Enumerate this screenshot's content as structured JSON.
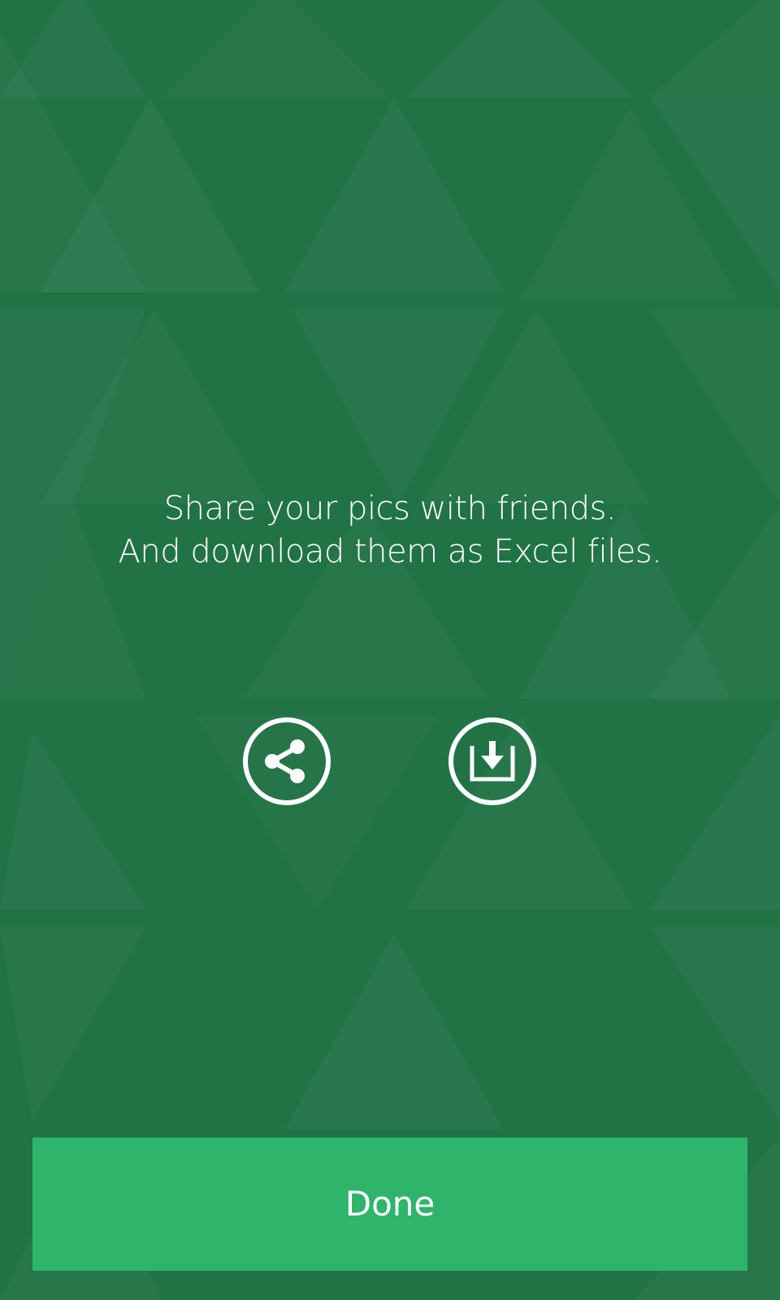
{
  "colors": {
    "background": "#217346",
    "accent_button": "#2eb46b",
    "text": "#ffffff"
  },
  "message": {
    "line1": "Share your pics with friends.",
    "line2": "And download them as Excel files."
  },
  "actions": [
    {
      "icon": "share-icon"
    },
    {
      "icon": "download-icon"
    }
  ],
  "footer": {
    "done_label": "Done"
  }
}
